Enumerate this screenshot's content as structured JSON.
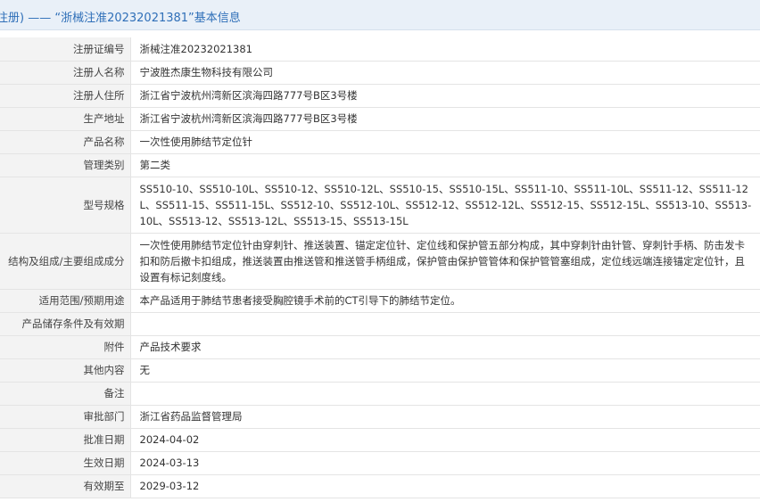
{
  "header": {
    "title": "注册) —— “浙械注准20232021381”基本信息"
  },
  "rows": [
    {
      "label": "注册证编号",
      "value": "浙械注准20232021381"
    },
    {
      "label": "注册人名称",
      "value": "宁波胜杰康生物科技有限公司"
    },
    {
      "label": "注册人住所",
      "value": "浙江省宁波杭州湾新区滨海四路777号B区3号楼"
    },
    {
      "label": "生产地址",
      "value": "浙江省宁波杭州湾新区滨海四路777号B区3号楼"
    },
    {
      "label": "产品名称",
      "value": "一次性使用肺结节定位针"
    },
    {
      "label": "管理类别",
      "value": "第二类"
    },
    {
      "label": "型号规格",
      "value": "SS510-10、SS510-10L、SS510-12、SS510-12L、SS510-15、SS510-15L、SS511-10、SS511-10L、SS511-12、SS511-12L、SS511-15、SS511-15L、SS512-10、SS512-10L、SS512-12、SS512-12L、SS512-15、SS512-15L、SS513-10、SS513-10L、SS513-12、SS513-12L、SS513-15、SS513-15L"
    },
    {
      "label": "结构及组成/主要组成成分",
      "value": "一次性使用肺结节定位针由穿刺针、推送装置、锚定定位针、定位线和保护管五部分构成，其中穿刺针由针管、穿刺针手柄、防击发卡扣和防后撤卡扣组成，推送装置由推送管和推送管手柄组成，保护管由保护管管体和保护管管塞组成，定位线远端连接锚定定位针，且设置有标记刻度线。"
    },
    {
      "label": "适用范围/预期用途",
      "value": "本产品适用于肺结节患者接受胸腔镜手术前的CT引导下的肺结节定位。"
    },
    {
      "label": "产品储存条件及有效期",
      "value": ""
    },
    {
      "label": "附件",
      "value": "产品技术要求"
    },
    {
      "label": "其他内容",
      "value": "无"
    },
    {
      "label": "备注",
      "value": ""
    },
    {
      "label": "审批部门",
      "value": "浙江省药品监督管理局"
    },
    {
      "label": "批准日期",
      "value": "2024-04-02"
    },
    {
      "label": "生效日期",
      "value": "2024-03-13"
    },
    {
      "label": "有效期至",
      "value": "2029-03-12"
    }
  ]
}
